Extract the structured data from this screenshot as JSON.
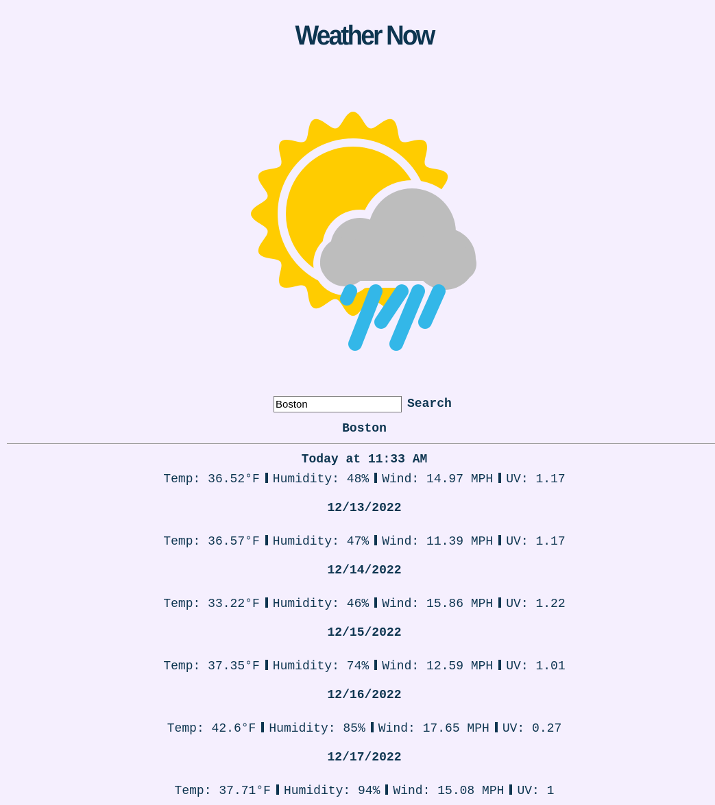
{
  "page": {
    "title": "Weather Now"
  },
  "weather_icon": "partly-sunny-rain-icon",
  "colors": {
    "background": "#f5effe",
    "text": "#0d3550",
    "sun": "#ffcc00",
    "cloud": "#bdbdbd",
    "rain": "#33b7e8"
  },
  "search": {
    "value": "Boston",
    "button_label": "Search"
  },
  "city": "Boston",
  "current": {
    "heading": "Today at 11:33 AM",
    "temp": "Temp: 36.52°F",
    "humidity": "Humidity: 48%",
    "wind": "Wind: 14.97 MPH",
    "uv": "UV: 1.17"
  },
  "forecast": [
    {
      "date": "12/13/2022",
      "temp": "Temp: 36.57°F",
      "humidity": "Humidity: 47%",
      "wind": "Wind: 11.39 MPH",
      "uv": "UV: 1.17"
    },
    {
      "date": "12/14/2022",
      "temp": "Temp: 33.22°F",
      "humidity": "Humidity: 46%",
      "wind": "Wind: 15.86 MPH",
      "uv": "UV: 1.22"
    },
    {
      "date": "12/15/2022",
      "temp": "Temp: 37.35°F",
      "humidity": "Humidity: 74%",
      "wind": "Wind: 12.59 MPH",
      "uv": "UV: 1.01"
    },
    {
      "date": "12/16/2022",
      "temp": "Temp: 42.6°F",
      "humidity": "Humidity: 85%",
      "wind": "Wind: 17.65 MPH",
      "uv": "UV: 0.27"
    },
    {
      "date": "12/17/2022",
      "temp": "Temp: 37.71°F",
      "humidity": "Humidity: 94%",
      "wind": "Wind: 15.08 MPH",
      "uv": "UV: 1"
    }
  ]
}
